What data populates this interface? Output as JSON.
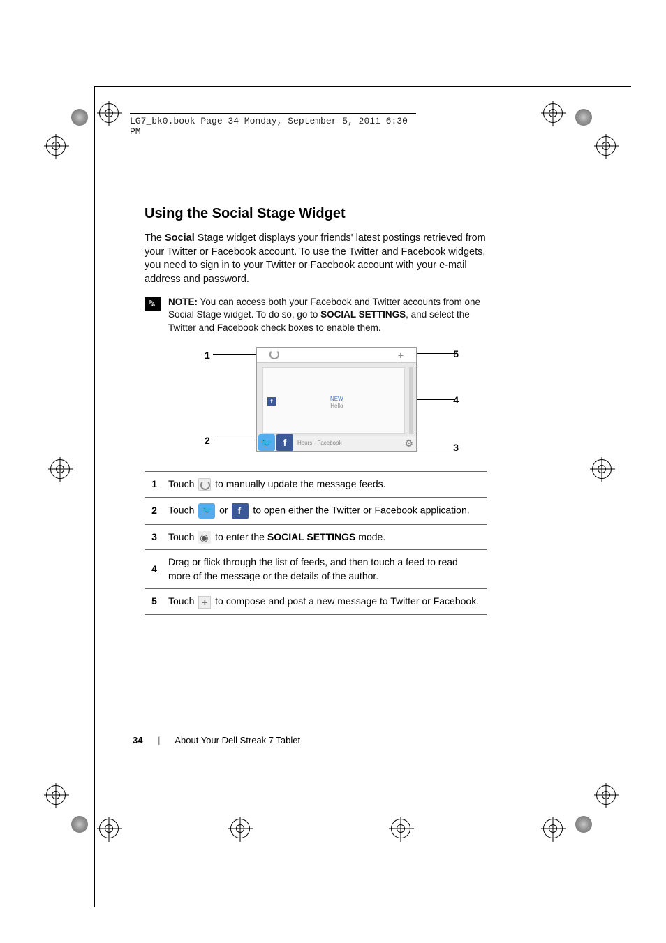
{
  "header": {
    "book_info": "LG7_bk0.book  Page 34  Monday, September 5, 2011  6:30 PM"
  },
  "heading": "Using the Social Stage Widget",
  "intro": {
    "p1_a": "The ",
    "p1_b": "Social",
    "p1_c": " Stage widget displays your friends' latest postings retrieved from your Twitter or Facebook account. To use the Twitter and Facebook widgets, you need to sign in to your Twitter or Facebook account with your e-mail address and password."
  },
  "note": {
    "label": "NOTE:",
    "text_a": " You can access both your Facebook and Twitter accounts from one Social Stage widget. To do so, go to ",
    "text_b": "SOCIAL SETTINGS",
    "text_c": ", and select the Twitter and Facebook check boxes to enable them."
  },
  "diagram": {
    "c1": "1",
    "c2": "2",
    "c3": "3",
    "c4": "4",
    "c5": "5",
    "feed_new": "NEW",
    "feed_hello": "Hello",
    "bottom_label": "Hours - Facebook"
  },
  "steps": [
    {
      "num": "1",
      "pre": "Touch ",
      "icon": "refresh",
      "post": " to manually update the message feeds."
    },
    {
      "num": "2",
      "pre": "Touch ",
      "icon": "twitter",
      "mid": " or ",
      "icon2": "facebook",
      "post": " to open either the Twitter or Facebook application."
    },
    {
      "num": "3",
      "pre": "Touch ",
      "icon": "gear",
      "post_a": " to enter the ",
      "post_b": "SOCIAL SETTINGS",
      "post_c": " mode."
    },
    {
      "num": "4",
      "text": "Drag or flick through the list of feeds, and then touch a feed to read more of the message or the details of the author."
    },
    {
      "num": "5",
      "pre": "Touch ",
      "icon": "plus",
      "post": " to compose and post a new message to Twitter or Facebook."
    }
  ],
  "footer": {
    "page": "34",
    "section": "About Your Dell Streak 7 Tablet"
  }
}
